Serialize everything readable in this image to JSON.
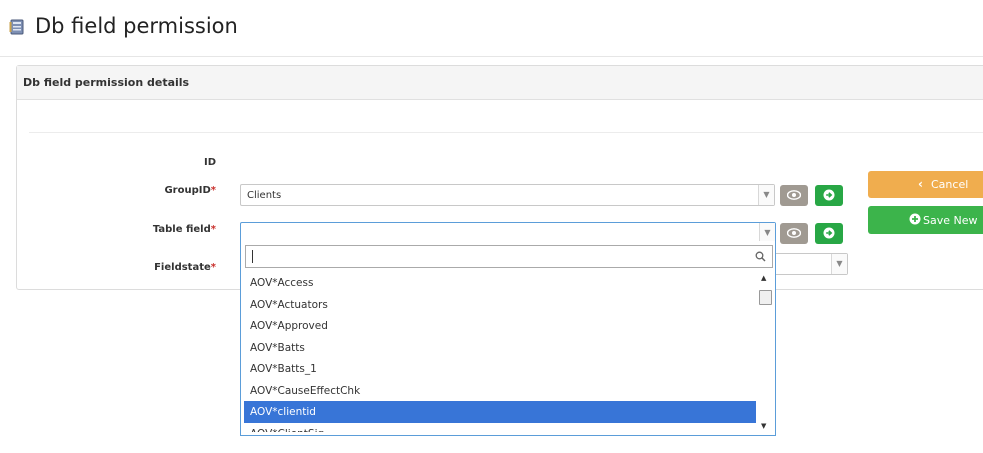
{
  "page": {
    "title": "Db field permission",
    "icon": "table-book-icon"
  },
  "panel": {
    "title": "Db field permission details"
  },
  "form": {
    "id_label": "ID",
    "group_label": "GroupID",
    "table_field_label": "Table field",
    "fieldstate_label": "Fieldstate",
    "required_mark": "*",
    "group_value": "Clients",
    "table_field_value": "",
    "fieldstate_value": ""
  },
  "buttons": {
    "cancel": "Cancel",
    "save_new": "Save New"
  },
  "dropdown": {
    "search_value": "",
    "items": [
      "AOV*Access",
      "AOV*Actuators",
      "AOV*Approved",
      "AOV*Batts",
      "AOV*Batts_1",
      "AOV*CauseEffectChk",
      "AOV*clientid",
      "AOV*ClientSig"
    ],
    "highlighted_index": 6
  },
  "colors": {
    "cancel": "#f0ad4e",
    "save": "#3cb44b",
    "go": "#28a745",
    "view": "#a09a92",
    "highlight": "#3875d7",
    "required": "#c9302c"
  }
}
